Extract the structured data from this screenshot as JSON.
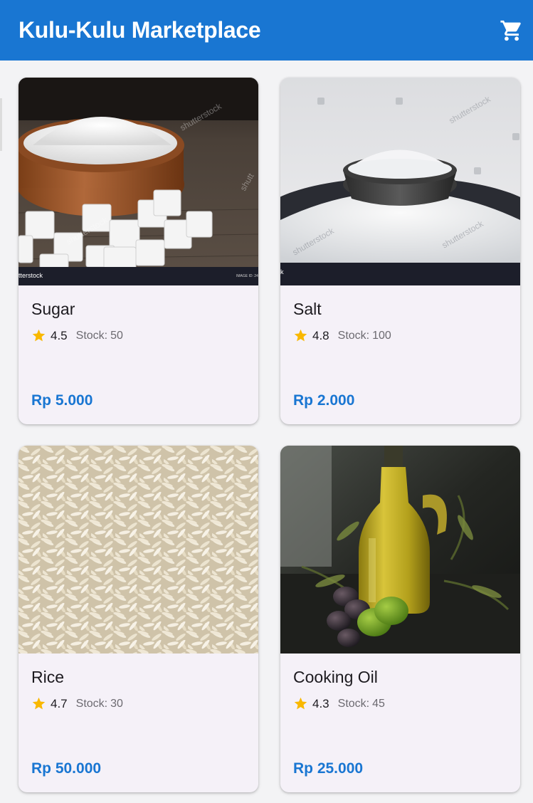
{
  "app": {
    "title": "Kulu-Kulu Marketplace",
    "cart_icon": "shopping-cart-icon",
    "accent_color": "#1976d2"
  },
  "products": [
    {
      "name": "Sugar",
      "rating": "4.5",
      "stock_label": "Stock:",
      "stock": "50",
      "price": "Rp 5.000",
      "image": "sugar-image"
    },
    {
      "name": "Salt",
      "rating": "4.8",
      "stock_label": "Stock:",
      "stock": "100",
      "price": "Rp 2.000",
      "image": "salt-image"
    },
    {
      "name": "Rice",
      "rating": "4.7",
      "stock_label": "Stock:",
      "stock": "30",
      "price": "Rp 50.000",
      "image": "rice-image"
    },
    {
      "name": "Cooking Oil",
      "rating": "4.3",
      "stock_label": "Stock:",
      "stock": "45",
      "price": "Rp 25.000",
      "image": "cooking-oil-image"
    }
  ],
  "rating_icon": "star-icon",
  "rating_color": "#f9b800"
}
